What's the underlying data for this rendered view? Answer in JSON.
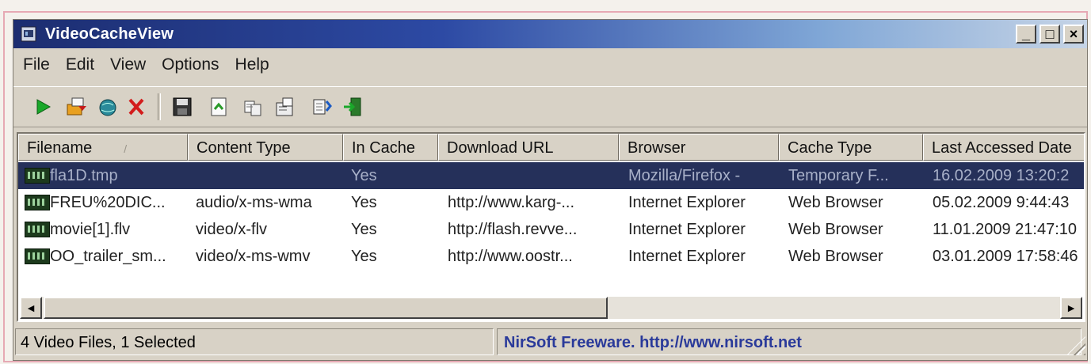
{
  "window": {
    "title": "VideoCacheView",
    "caption_buttons": [
      "_",
      "□",
      "×"
    ]
  },
  "menu": [
    "File",
    "Edit",
    "View",
    "Options",
    "Help"
  ],
  "toolbar": {
    "icons": [
      "play-icon",
      "copy-files-icon",
      "web-icon",
      "delete-icon",
      "save-icon",
      "html-report-icon",
      "copy-icon",
      "properties-icon",
      "refresh-icon",
      "exit-icon"
    ]
  },
  "table": {
    "columns": [
      "Filename",
      "Content Type",
      "In Cache",
      "Download URL",
      "Browser",
      "Cache Type",
      "Last Accessed Date"
    ],
    "sort_indicator": "/",
    "rows": [
      {
        "filename": "fla1D.tmp",
        "content_type": "",
        "in_cache": "Yes",
        "download_url": "",
        "browser": "Mozilla/Firefox -",
        "cache_type": "Temporary F...",
        "last_accessed": "16.02.2009 13:20:2",
        "selected": true
      },
      {
        "filename": "FREU%20DIC...",
        "content_type": "audio/x-ms-wma",
        "in_cache": "Yes",
        "download_url": "http://www.karg-...",
        "browser": "Internet Explorer",
        "cache_type": "Web Browser",
        "last_accessed": "05.02.2009 9:44:43",
        "selected": false
      },
      {
        "filename": "movie[1].flv",
        "content_type": "video/x-flv",
        "in_cache": "Yes",
        "download_url": "http://flash.revve...",
        "browser": "Internet Explorer",
        "cache_type": "Web Browser",
        "last_accessed": "11.01.2009 21:47:10",
        "selected": false
      },
      {
        "filename": "OO_trailer_sm...",
        "content_type": "video/x-ms-wmv",
        "in_cache": "Yes",
        "download_url": "http://www.oostr...",
        "browser": "Internet Explorer",
        "cache_type": "Web Browser",
        "last_accessed": "03.01.2009 17:58:46",
        "selected": false
      }
    ]
  },
  "scrollbar": {
    "left_arrow": "◄",
    "right_arrow": "►"
  },
  "statusbar": {
    "count": "4 Video Files, 1 Selected",
    "credit": "NirSoft Freeware.  http://www.nirsoft.net"
  },
  "colors": {
    "selection_bg": "#25305a",
    "titlebar_start": "#1c2d70",
    "link": "#2a3a9a"
  }
}
